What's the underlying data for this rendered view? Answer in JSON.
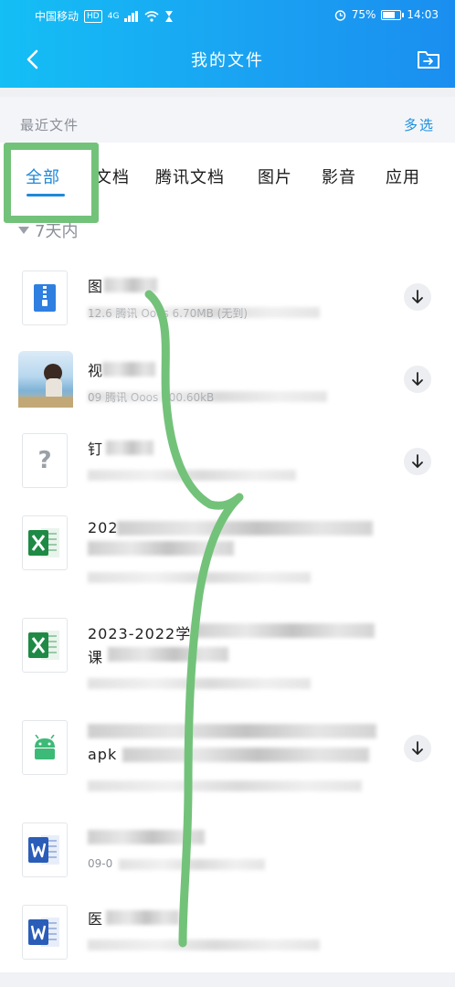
{
  "status_bar": {
    "carrier": "中国移动",
    "hd": "HD",
    "signal": "4G",
    "battery": "75%",
    "battery_level": 0.75,
    "time": "14:03"
  },
  "header": {
    "title": "我的文件"
  },
  "recent": {
    "label": "最近文件",
    "multi_select": "多选"
  },
  "tabs": [
    {
      "label": "全部",
      "active": true
    },
    {
      "label": "文档"
    },
    {
      "label": "腾讯文档"
    },
    {
      "label": "图片"
    },
    {
      "label": "影音"
    },
    {
      "label": "应用"
    }
  ],
  "section": {
    "label": "7天内"
  },
  "files": [
    {
      "icon": "zip-icon",
      "name": "图",
      "meta": "12.6 腾讯 Ooos 6.70MB (无到)",
      "download": true
    },
    {
      "icon": "photo-thumbnail",
      "name": "视",
      "meta": "09 腾讯 Ooos 300.60kB",
      "download": true
    },
    {
      "icon": "unknown-file-icon",
      "name": "钉",
      "meta": "",
      "download": true
    },
    {
      "icon": "excel-icon",
      "name": "202",
      "meta": "",
      "download": false
    },
    {
      "icon": "excel-icon",
      "name": "2023-2022学",
      "name2": "课",
      "meta": "",
      "download": false
    },
    {
      "icon": "android-apk-icon",
      "name": "",
      "name2": "apk",
      "meta": "",
      "download": true
    },
    {
      "icon": "word-icon",
      "name": "",
      "meta": "09-0",
      "download": false
    },
    {
      "icon": "word-icon",
      "name": "医",
      "meta": "",
      "download": false
    }
  ],
  "colors": {
    "header_start": "#14bff5",
    "header_end": "#1a8ef0",
    "accent": "#1f88d8",
    "annotation_green": "#73c27a",
    "excel_green": "#1e8a45",
    "word_blue": "#2a5db8",
    "zip_blue": "#2f7fe0",
    "android_green": "#3dba77"
  }
}
